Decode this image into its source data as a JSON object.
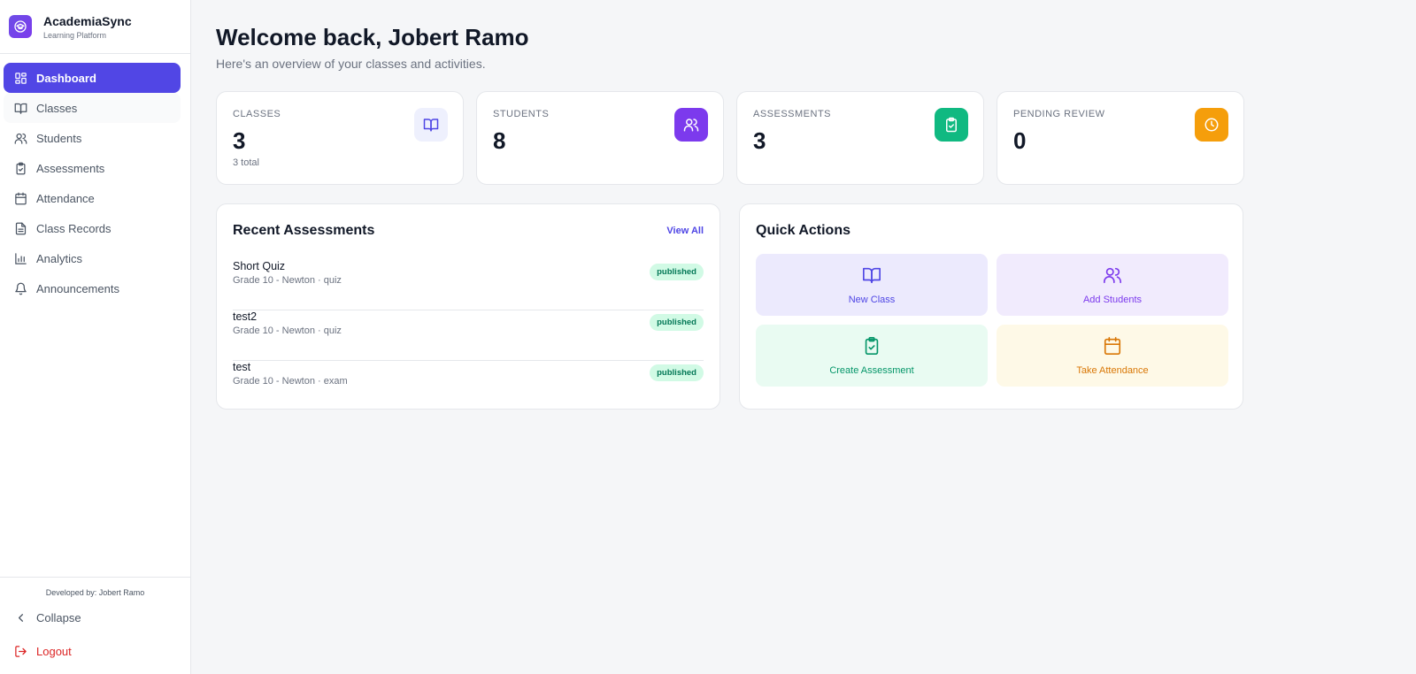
{
  "brand": {
    "name": "AcademiaSync",
    "subtitle": "Learning Platform",
    "icon": "graduation-cap-icon"
  },
  "nav": {
    "items": [
      {
        "label": "Dashboard",
        "icon": "dashboard-icon",
        "active": true
      },
      {
        "label": "Classes",
        "icon": "book-icon"
      },
      {
        "label": "Students",
        "icon": "users-icon"
      },
      {
        "label": "Assessments",
        "icon": "clipboard-check-icon"
      },
      {
        "label": "Attendance",
        "icon": "calendar-icon"
      },
      {
        "label": "Class Records",
        "icon": "file-text-icon"
      },
      {
        "label": "Analytics",
        "icon": "bar-chart-icon"
      },
      {
        "label": "Announcements",
        "icon": "bell-icon"
      }
    ]
  },
  "footer": {
    "developer": "Developed by: Jobert Ramo",
    "collapse": "Collapse",
    "logout": "Logout"
  },
  "header": {
    "title": "Welcome back, Jobert Ramo",
    "subtitle": "Here's an overview of your classes and activities."
  },
  "stats": [
    {
      "label": "CLASSES",
      "value": "3",
      "note": "3 total",
      "icon": "book-icon",
      "color": "#4f46e5",
      "bg": "#eef0fd"
    },
    {
      "label": "STUDENTS",
      "value": "8",
      "note": "",
      "icon": "users-icon",
      "color": "#ffffff",
      "bg": "#7c3aed"
    },
    {
      "label": "ASSESSMENTS",
      "value": "3",
      "note": "",
      "icon": "clipboard-check-icon",
      "color": "#ffffff",
      "bg": "#10b981"
    },
    {
      "label": "PENDING REVIEW",
      "value": "0",
      "note": "",
      "icon": "clock-icon",
      "color": "#ffffff",
      "bg": "#f59e0b"
    }
  ],
  "recent": {
    "title": "Recent Assessments",
    "view_all": "View All",
    "items": [
      {
        "name": "Short Quiz",
        "meta": "Grade 10 - Newton · quiz",
        "status": "published"
      },
      {
        "name": "test2",
        "meta": "Grade 10 - Newton · quiz",
        "status": "published"
      },
      {
        "name": "test",
        "meta": "Grade 10 - Newton · exam",
        "status": "published"
      }
    ]
  },
  "quick": {
    "title": "Quick Actions",
    "actions": [
      {
        "label": "New Class",
        "icon": "book-icon",
        "color": "#4f46e5",
        "bg": "#eceafd"
      },
      {
        "label": "Add Students",
        "icon": "users-icon",
        "color": "#7c3aed",
        "bg": "#f1ebfd"
      },
      {
        "label": "Create Assessment",
        "icon": "clipboard-check-icon",
        "color": "#059669",
        "bg": "#e9fbf2"
      },
      {
        "label": "Take Attendance",
        "icon": "calendar-icon",
        "color": "#d97706",
        "bg": "#fef9e7"
      }
    ]
  }
}
